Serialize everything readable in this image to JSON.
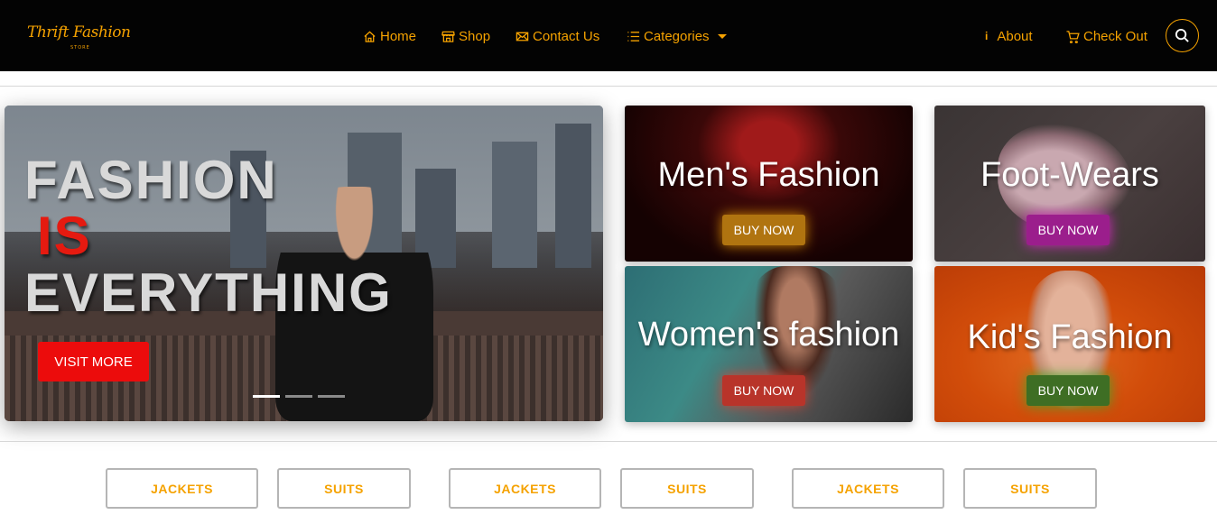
{
  "brand": {
    "logo_text": "Thrift Fashion",
    "logo_sub": "STORE",
    "accent_color": "#f5a200"
  },
  "nav": {
    "home": "Home",
    "shop": "Shop",
    "contact": "Contact Us",
    "categories": "Categories",
    "about": "About",
    "about_icon": "i",
    "checkout": "Check Out"
  },
  "hero": {
    "line1": "FASHION",
    "line2": "IS",
    "line3": "EVERYTHING",
    "cta": "VISIT MORE",
    "active_slide": 1,
    "slide_count": 3
  },
  "cards": {
    "men": {
      "title": "Men's Fashion",
      "button": "BUY NOW"
    },
    "foot": {
      "title": "Foot-Wears",
      "button": "BUY NOW"
    },
    "women": {
      "title": "Women's fashion",
      "button": "BUY NOW"
    },
    "kid": {
      "title": "Kid's Fashion",
      "button": "BUY NOW"
    }
  },
  "categories": [
    {
      "label": "JACKETS"
    },
    {
      "label": "SUITS"
    },
    {
      "label": "JACKETS"
    },
    {
      "label": "SUITS"
    },
    {
      "label": "JACKETS"
    },
    {
      "label": "SUITS"
    }
  ]
}
